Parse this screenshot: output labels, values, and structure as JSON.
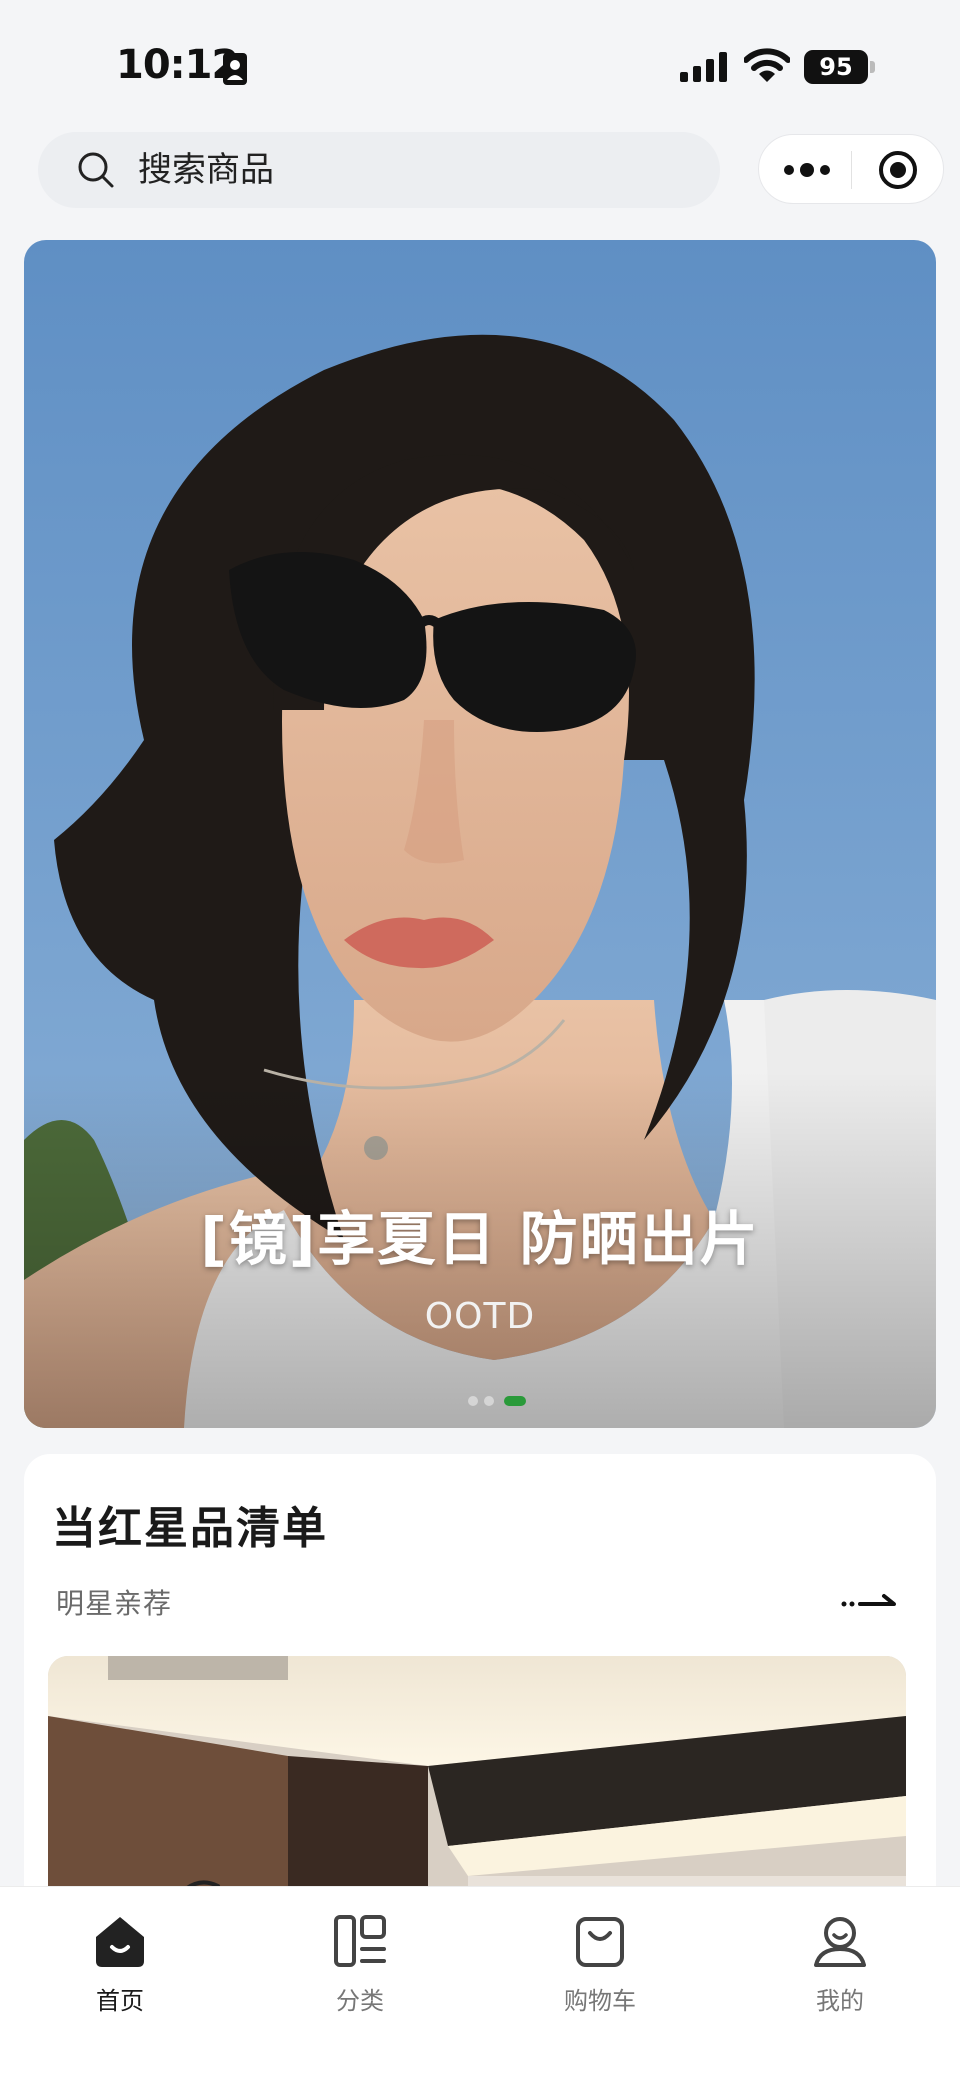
{
  "status_bar": {
    "time": "10:12",
    "battery": "95"
  },
  "search": {
    "placeholder": "搜索商品"
  },
  "capsule": {
    "more_icon": "more-dots-icon",
    "close_icon": "target-icon"
  },
  "banner": {
    "title": "[镜]享夏日 防晒出片",
    "subtitle": "OOTD",
    "slide_count": 3,
    "active_slide": 3
  },
  "section": {
    "title": "当红星品清单",
    "subtitle": "明星亲荐"
  },
  "tabs": [
    {
      "label": "首页",
      "icon": "home-icon",
      "active": true
    },
    {
      "label": "分类",
      "icon": "category-icon",
      "active": false
    },
    {
      "label": "购物车",
      "icon": "cart-icon",
      "active": false
    },
    {
      "label": "我的",
      "icon": "profile-icon",
      "active": false
    }
  ],
  "colors": {
    "accent_dot": "#2a9a3a",
    "background": "#f4f5f7",
    "text_primary": "#1a1a1a"
  }
}
